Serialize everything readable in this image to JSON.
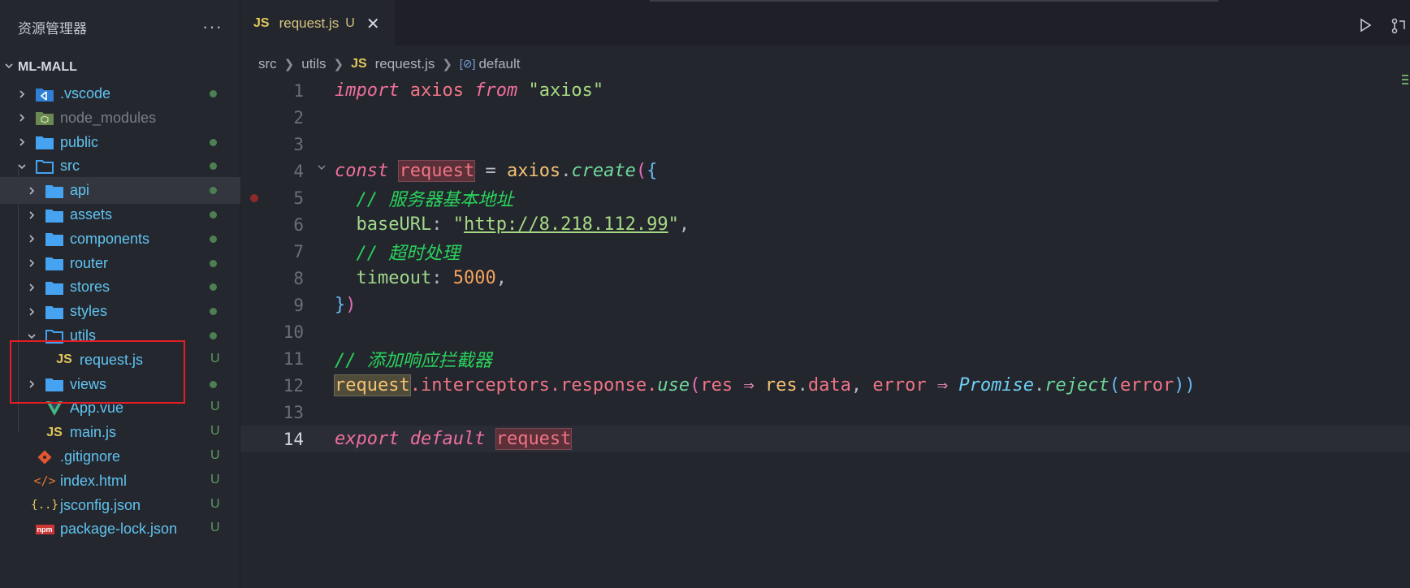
{
  "sidebar": {
    "title": "资源管理器",
    "more": "···",
    "project": "ML-MALL",
    "items": [
      {
        "label": ".vscode",
        "icon": "vscode-folder-icon",
        "status": "dot",
        "color": "#5fc4f0"
      },
      {
        "label": "node_modules",
        "icon": "node-modules-folder-icon",
        "status": "",
        "color": "#7a7d87"
      },
      {
        "label": "public",
        "icon": "folder-icon",
        "status": "dot",
        "color": "#5fc4f0"
      },
      {
        "label": "src",
        "icon": "folder-open-icon",
        "status": "dot",
        "color": "#5fc4f0"
      },
      {
        "label": "api",
        "icon": "folder-icon",
        "status": "dot",
        "color": "#5fc4f0"
      },
      {
        "label": "assets",
        "icon": "folder-icon",
        "status": "dot",
        "color": "#5fc4f0"
      },
      {
        "label": "components",
        "icon": "folder-icon",
        "status": "dot",
        "color": "#5fc4f0"
      },
      {
        "label": "router",
        "icon": "folder-icon",
        "status": "dot",
        "color": "#5fc4f0"
      },
      {
        "label": "stores",
        "icon": "folder-icon",
        "status": "dot",
        "color": "#5fc4f0"
      },
      {
        "label": "styles",
        "icon": "folder-icon",
        "status": "dot",
        "color": "#5fc4f0"
      },
      {
        "label": "utils",
        "icon": "folder-open-icon",
        "status": "dot",
        "color": "#5fc4f0"
      },
      {
        "label": "request.js",
        "icon": "js-file-icon",
        "status": "U",
        "color": "#5fc4f0"
      },
      {
        "label": "views",
        "icon": "folder-icon",
        "status": "dot",
        "color": "#5fc4f0"
      },
      {
        "label": "App.vue",
        "icon": "vue-file-icon",
        "status": "U",
        "color": "#5fc4f0"
      },
      {
        "label": "main.js",
        "icon": "js-file-icon",
        "status": "U",
        "color": "#5fc4f0"
      },
      {
        "label": ".gitignore",
        "icon": "git-file-icon",
        "status": "U",
        "color": "#5fc4f0"
      },
      {
        "label": "index.html",
        "icon": "html-file-icon",
        "status": "U",
        "color": "#5fc4f0"
      },
      {
        "label": "jsconfig.json",
        "icon": "json-file-icon",
        "status": "U",
        "color": "#5fc4f0"
      },
      {
        "label": "package-lock.json",
        "icon": "npm-file-icon",
        "status": "U",
        "color": "#5fc4f0"
      }
    ]
  },
  "tab": {
    "badge": "JS",
    "label": "request.js",
    "status": "U",
    "close": "✕"
  },
  "breadcrumb": {
    "parts": [
      "src",
      "utils"
    ],
    "file_badge": "JS",
    "file": "request.js",
    "symbol_icon": "[⊘]",
    "symbol": "default"
  },
  "editor": {
    "line_numbers": [
      "1",
      "2",
      "3",
      "4",
      "5",
      "6",
      "7",
      "8",
      "9",
      "10",
      "11",
      "12",
      "13",
      "14"
    ],
    "current_line": 14,
    "tokens": {
      "l1_import": "import",
      "l1_axios": "axios",
      "l1_from": "from",
      "l1_str": "\"axios\"",
      "l4_const": "const",
      "l4_request": "request",
      "l4_eq": " = ",
      "l4_axios": "axios",
      "l4_dot": ".",
      "l4_create": "create",
      "l4_paren": "(",
      "l4_brace": "{",
      "l5_cmt": "// 服务器基本地址",
      "l6_key": "baseURL",
      "l6_colon": ": ",
      "l6_q1": "\"",
      "l6_url": "http://8.218.112.99",
      "l6_q2": "\"",
      "l6_comma": ",",
      "l7_cmt": "// 超时处理",
      "l8_key": "timeout",
      "l8_colon": ": ",
      "l8_num": "5000",
      "l8_comma": ",",
      "l9_brace": "}",
      "l9_paren": ")",
      "l11_cmt": "// 添加响应拦截器",
      "l12_request": "request",
      "l12_chain": ".interceptors.response.",
      "l12_use": "use",
      "l12_p1": "(",
      "l12_res": "res",
      "l12_arrow": " ⇒ ",
      "l12_res2": "res",
      "l12_dot": ".",
      "l12_data": "data",
      "l12_comma": ", ",
      "l12_err": "error",
      "l12_arrow2": " ⇒ ",
      "l12_promise": "Promise",
      "l12_dot2": ".",
      "l12_reject": "reject",
      "l12_p2": "(",
      "l12_err2": "error",
      "l12_p3": "))",
      "l14_export": "export",
      "l14_default": "default",
      "l14_request": "request"
    }
  }
}
